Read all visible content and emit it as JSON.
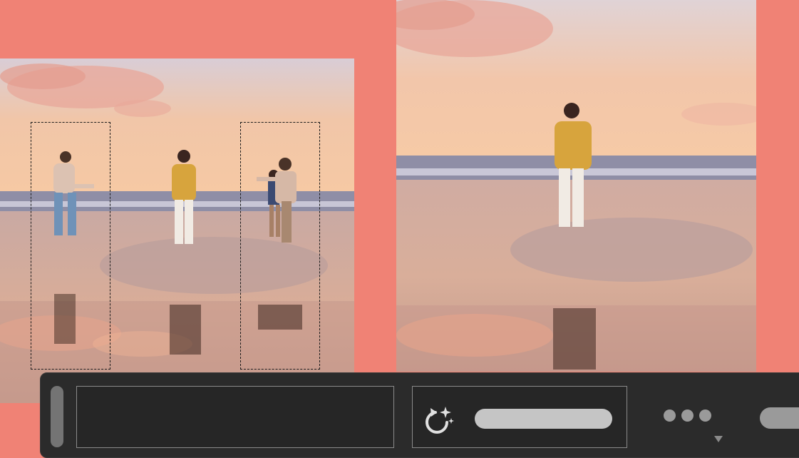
{
  "canvas": {
    "background_color": "#f08275"
  },
  "photos": {
    "before": {
      "people_count": 4,
      "selection_boxes": 2
    },
    "after": {
      "people_count": 1
    }
  },
  "toolbar": {
    "background_color": "#2b2b2b",
    "ai_icon": "sparkle-refresh-icon",
    "slider_color": "#c5c5c5",
    "more_icon": "more-dots-icon",
    "dropdown_icon": "caret-down-icon"
  }
}
